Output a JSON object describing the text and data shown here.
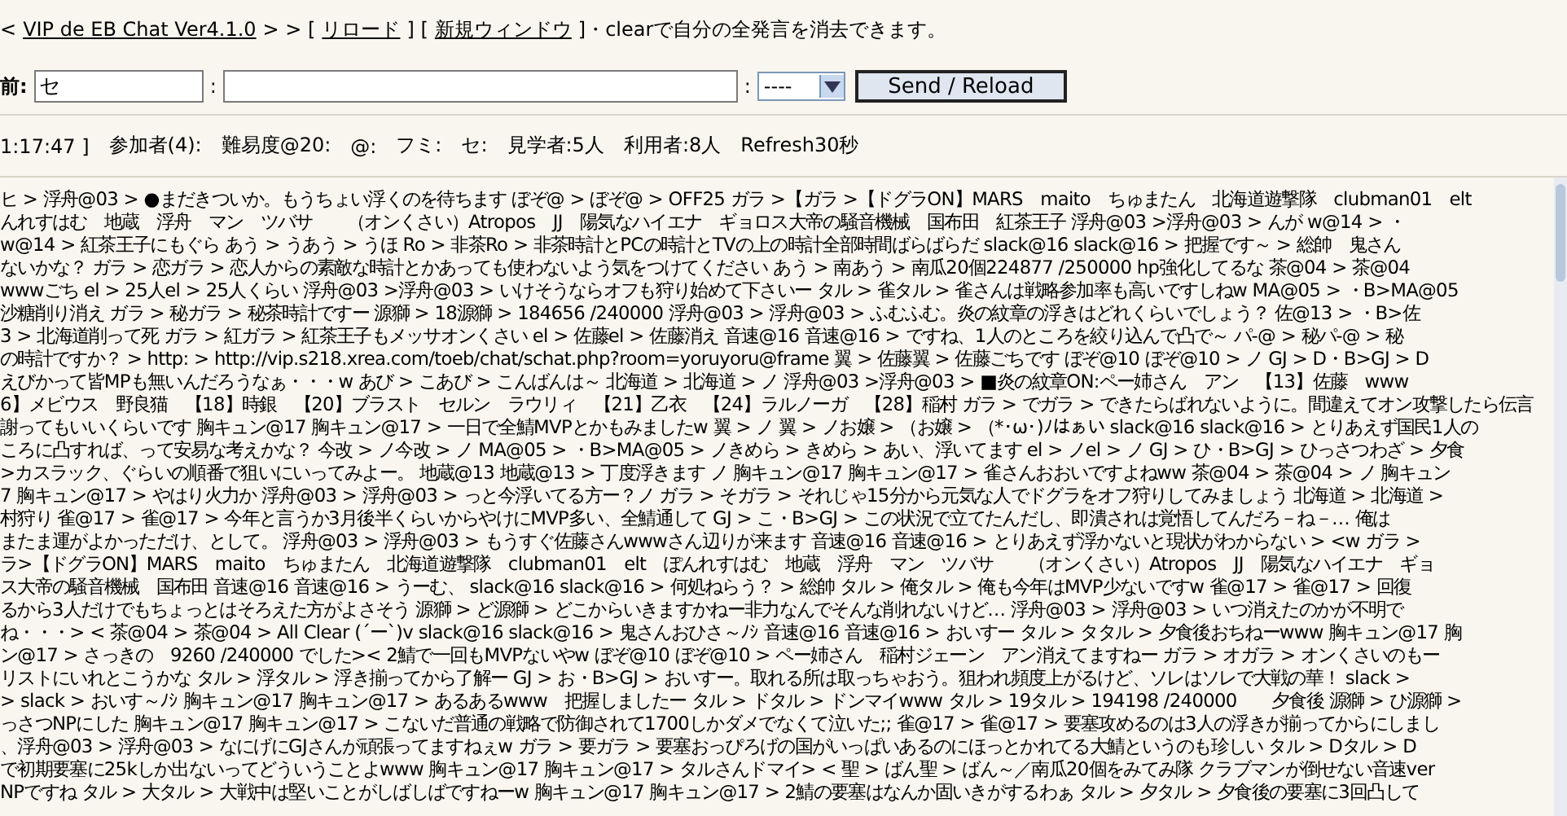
{
  "header": {
    "parts": [
      {
        "kind": "text",
        "text": "<"
      },
      {
        "kind": "link",
        "text": "VIP de EB Chat Ver4.1.0"
      },
      {
        "kind": "text",
        "text": "> > ["
      },
      {
        "kind": "link",
        "text": "リロード"
      },
      {
        "kind": "text",
        "text": "] ["
      },
      {
        "kind": "link",
        "text": "新規ウィンドウ"
      },
      {
        "kind": "text",
        "text": "]・clearで自分の全発言を消去できます。"
      }
    ]
  },
  "form": {
    "name_label": "前:",
    "name_value": "セ",
    "separator": ":",
    "select_value": "----",
    "button": "Send / Reload"
  },
  "status": {
    "items": [
      "1:17:47 ]",
      "参加者(4):",
      "難易度@20:",
      "@:",
      "フミ:",
      "セ:",
      "見学者:5人",
      "利用者:8人",
      "Refresh30秒"
    ]
  },
  "log": {
    "lines": [
      "ヒ > 浮舟@03 > ●まだきついか。もうちょい浮くのを待ちます ぼぞ@ > ぼぞ@ > OFF25 ガラ >【ガラ >【ドグラON】MARS　maito　ちゅまたん　北海道遊撃隊　clubman01　elt",
      "んれすはむ　地蔵　浮舟　マン　ツバサ　　（オンくさい）Atropos　JJ　陽気なハイエナ　ギョロス大帝の騒音機械　国布田　紅茶王子 浮舟@03 >浮舟@03 > んが w@14 > ・",
      "w@14 > 紅茶王子にもぐら あう > うあう > うほ Ro > 非茶Ro > 非茶時計とPCの時計とTVの上の時計全部時間ばらばらだ slack@16 slack@16 > 把握です～ > 総帥　鬼さん",
      "ないかな？ ガラ > 恋ガラ > 恋人からの素敵な時計とかあっても使わないよう気をつけてください あう > 南あう > 南瓜20個224877 /250000 hp強化してるな 茶@04 > 茶@04",
      "wwwごち el > 25人el > 25人くらい 浮舟@03 >浮舟@03 > いけそうならオフも狩り始めて下さいー タル > 雀タル > 雀さんは戦略参加率も高いですしねw MA@05 > ・B>MA@05",
      "沙糖削り消え ガラ > 秘ガラ > 秘茶時計ですー 源獅 > 18源獅 > 184656 /240000 浮舟@03 > 浮舟@03 > ふむふむ。炎の紋章の浮きはどれくらいでしょう？ 佐@13 > ・B>佐",
      "3 > 北海道削って死 ガラ > 紅ガラ > 紅茶王子もメッサオンくさい el > 佐藤el > 佐藤消え 音速@16 音速@16 > ですね、1人のところを絞り込んで凸で～ パ-@ > 秘パ-@ > 秘",
      "の時計ですか？ > http: > http://vip.s218.xrea.com/toeb/chat/schat.php?room=yoruyoru@frame 翼 > 佐藤翼 > 佐藤ごちです ぼぞ@10 ぼぞ@10 > ノ GJ > D・B>GJ > D",
      "えびかって皆MPも無いんだろうなぁ・・・w あび > こあび > こんばんは～ 北海道 > 北海道 > ノ 浮舟@03 >浮舟@03 > ■炎の紋章ON:ペー姉さん　アン　【13】佐藤　www",
      "6】メビウス　野良猫　【18】時銀　【20】ブラスト　セルン　ラウリィ　【21】乙衣　【24】ラルノーガ　【28】稲村 ガラ > でガラ > できたらばれないように。間違えてオン攻撃したら伝言",
      "謝ってもいいくらいです 胸キュン@17 胸キュン@17 > 一日で全鯖MVPとかもみましたw 翼 > ノ 翼 > ノお嬢 > （お嬢 > （*･ω･)ﾉはぁい slack@16 slack@16 > とりあえず国民1人の",
      "ころに凸すれば、って安易な考えかな？ 今改 > ノ今改 > ノ MA@05 > ・B>MA@05 > ノきめら > きめら > あい、浮いてます el > ノel > ノ GJ > ひ・B>GJ > ひっさつわざ > 夕食",
      ">カスラック、ぐらいの順番で狙いにいってみよー。 地蔵@13 地蔵@13 > 丁度浮きます ノ 胸キュン@17 胸キュン@17 > 雀さんおおいですよねww 茶@04 > 茶@04 > ノ 胸キュン",
      "7 胸キュン@17 > やはり火力か 浮舟@03 > 浮舟@03 > っと今浮いてる方ー？ノ ガラ > そガラ > それじゃ15分から元気な人でドグラをオフ狩りしてみましょう 北海道 > 北海道 >",
      "村狩り 雀@17 > 雀@17 > 今年と言うか3月後半くらいからやけにMVP多い、全鯖通して GJ > こ・B>GJ > この状況で立てたんだし、即潰されは覚悟してんだろ－ね－… 俺は",
      "またま運がよかっただけ、として。 浮舟@03 > 浮舟@03 > もうすぐ佐藤さんwwwさん辺りが来ます 音速@16 音速@16 > とりあえず浮かないと現状がわからない > <w ガラ >",
      "ラ>【ドグラON】MARS　maito　ちゅまたん　北海道遊撃隊　clubman01　elt　ぽんれすはむ　地蔵　浮舟　マン　ツバサ　　（オンくさい）Atropos　JJ　陽気なハイエナ　ギョ",
      "ス大帝の騒音機械　国布田 音速@16 音速@16 > うーむ、 slack@16 slack@16 > 何処ねらう？ > 総帥 タル > 俺タル > 俺も今年はMVP少ないですw 雀@17 > 雀@17 > 回復",
      "るから3人だけでもちょっとはそろえた方がよさそう 源獅 > ど源獅 > どこからいきますかねー非力なんでそんな削れないけど… 浮舟@03 > 浮舟@03 > いつ消えたのかが不明で",
      "ね・・・> < 茶@04 > 茶@04 > All Clear (´ー`)v slack@16 slack@16 > 鬼さんおひさ～ﾉｼ 音速@16 音速@16 > おいすー タル > タタル > 夕食後おちねーwww 胸キュン@17 胸",
      "ン@17 > さっきの　9260 /240000 でした>< 2鯖で一回もMVPないやw ぼぞ@10 ぼぞ@10 > ペー姉さん　稲村ジェーン　アン消えてますねー ガラ > オガラ > オンくさいのもー",
      "リストにいれとこうかな タル > 浮タル > 浮き揃ってから了解ー GJ > お・B>GJ > おいすー。取れる所は取っちゃおう。狙われ頻度上がるけど、ソレはソレで大戦の華！ slack >",
      "> slack > おいす～ﾉｼ 胸キュン@17 胸キュン@17 > あるあるwww　把握しましたー タル > ドタル > ドンマイwww タル > 19タル > 194198 /240000　　夕食後 源獅 > ひ源獅 >",
      "っさつNPにした 胸キュン@17 胸キュン@17 > こないだ普通の戦略で防御されて1700しかダメでなくて泣いた;; 雀@17 > 雀@17 > 要塞攻めるのは3人の浮きが揃ってからにしまし",
      "、浮舟@03 > 浮舟@03 > なにげにGJさんが頑張ってますねぇw ガラ > 要ガラ > 要塞おっぴろげの国がいっぱいあるのにほっとかれてる大鯖というのも珍しい タル > Dタル > D",
      "で初期要塞に25kしか出ないってどういうことよwww 胸キュン@17 胸キュン@17 > タルさんドマイ> < 聖 > ばん聖 > ばん～／南瓜20個をみてみ隊 クラブマンが倒せない音速ver",
      "NPですね タル > 大タル > 大戦中は堅いことがしばしばですねーw 胸キュン@17 胸キュン@17 > 2鯖の要塞はなんか固いきがするわぁ タル > 夕タル > 夕食後の要塞に3回凸して"
    ]
  }
}
